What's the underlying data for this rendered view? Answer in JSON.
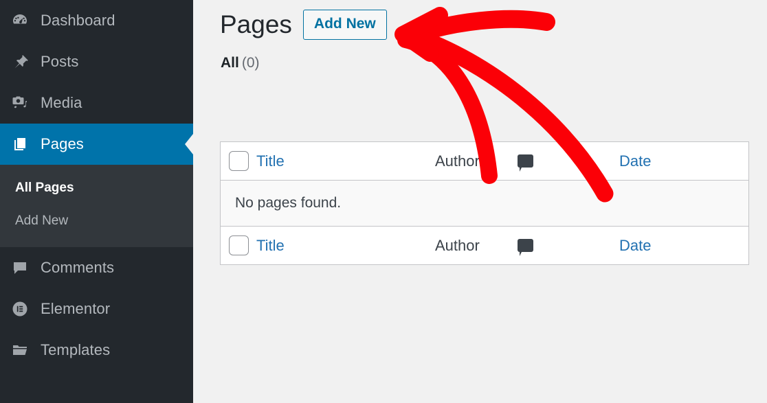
{
  "sidebar": {
    "items": [
      {
        "label": "Dashboard",
        "icon": "dashboard-gauge-icon",
        "name": "dashboard",
        "active": false
      },
      {
        "label": "Posts",
        "icon": "pushpin-icon",
        "name": "posts",
        "active": false
      },
      {
        "label": "Media",
        "icon": "camera-music-icon",
        "name": "media",
        "active": false
      },
      {
        "label": "Pages",
        "icon": "pages-stack-icon",
        "name": "pages",
        "active": true
      },
      {
        "label": "Comments",
        "icon": "comment-bubble-icon",
        "name": "comments",
        "active": false
      },
      {
        "label": "Elementor",
        "icon": "elementor-logo-icon",
        "name": "elementor",
        "active": false
      },
      {
        "label": "Templates",
        "icon": "folder-icon",
        "name": "templates",
        "active": false
      }
    ],
    "submenu": [
      {
        "label": "All Pages",
        "current": true
      },
      {
        "label": "Add New",
        "current": false
      }
    ]
  },
  "header": {
    "title": "Pages",
    "add_new_label": "Add New"
  },
  "filters": {
    "all_label": "All",
    "all_count": "(0)"
  },
  "table": {
    "columns": {
      "title": "Title",
      "author": "Author",
      "comments_icon": "comment-bubble-icon",
      "date": "Date"
    },
    "empty_message": "No pages found."
  },
  "colors": {
    "sidebar_bg": "#23282d",
    "submenu_bg": "#32373c",
    "active_blue": "#0073aa",
    "link_blue": "#2271b1",
    "content_bg": "#f1f1f1",
    "annotation_red": "#fb0007"
  }
}
